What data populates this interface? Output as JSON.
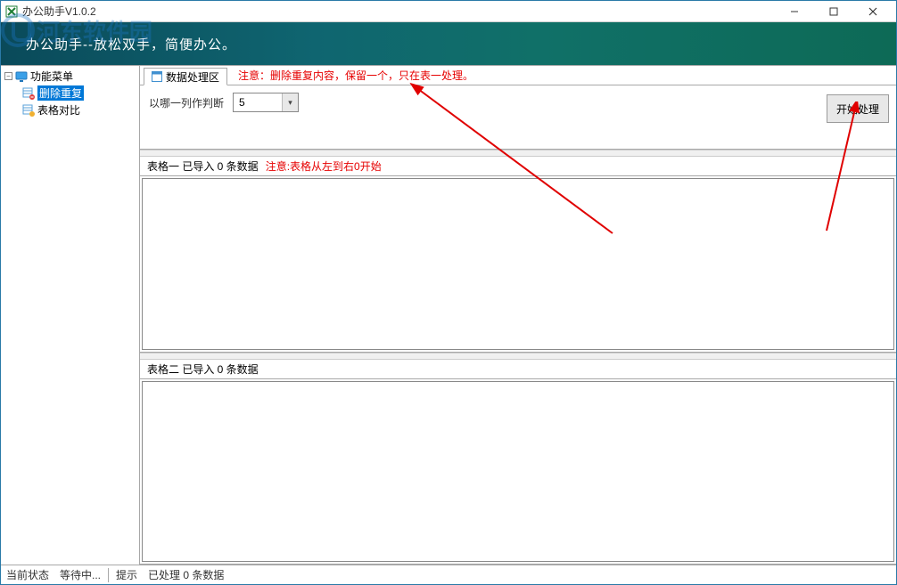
{
  "window": {
    "title": "办公助手V1.0.2"
  },
  "banner": {
    "slogan": "办公助手--放松双手，简便办公。",
    "watermark": "河东软件园"
  },
  "sidebar": {
    "root": "功能菜单",
    "items": [
      {
        "label": "删除重复",
        "selected": true
      },
      {
        "label": "表格对比",
        "selected": false
      }
    ]
  },
  "tab": {
    "label": "数据处理区"
  },
  "notes": {
    "top": "注意：删除重复内容，保留一个，只在表一处理。",
    "table1": "注意:表格从左到右0开始"
  },
  "controls": {
    "judge_label": "以哪一列作判断",
    "judge_value": "5",
    "start_label": "开始处理"
  },
  "tables": {
    "t1_label": "表格一  已导入 0 条数据",
    "t2_label": "表格二  已导入 0 条数据"
  },
  "status": {
    "state_label": "当前状态",
    "state_value": "等待中...",
    "hint_label": "提示",
    "hint_value": "已处理 0 条数据"
  }
}
